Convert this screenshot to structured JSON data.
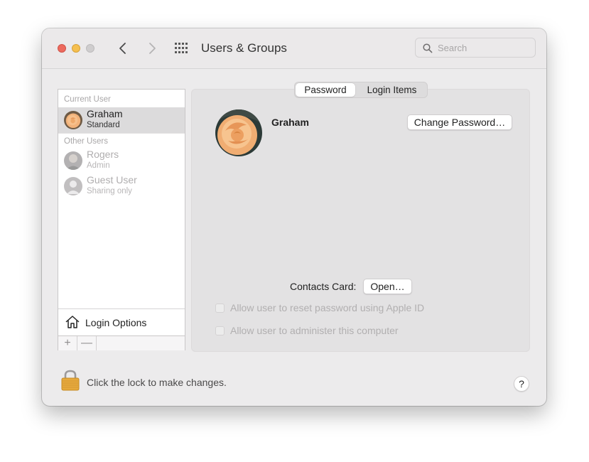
{
  "window": {
    "title": "Users & Groups",
    "search_placeholder": "Search"
  },
  "sidebar": {
    "current_user_label": "Current User",
    "other_users_label": "Other Users",
    "users": [
      {
        "name": "Graham",
        "role": "Standard",
        "avatar": "rose-photo",
        "selected": true,
        "enabled": true
      },
      {
        "name": "Rogers",
        "role": "Admin",
        "avatar": "person-photo",
        "selected": false,
        "enabled": false
      },
      {
        "name": "Guest User",
        "role": "Sharing only",
        "avatar": "generic-person-icon",
        "selected": false,
        "enabled": false
      }
    ],
    "login_options_label": "Login Options",
    "add_label": "+",
    "remove_label": "—"
  },
  "main": {
    "tabs": [
      {
        "label": "Password",
        "selected": true
      },
      {
        "label": "Login Items",
        "selected": false
      }
    ],
    "user_name": "Graham",
    "change_password_label": "Change Password…",
    "contacts_card_label": "Contacts Card:",
    "open_label": "Open…",
    "checkbox_reset": {
      "label": "Allow user to reset password using Apple ID",
      "checked": false,
      "enabled": false
    },
    "checkbox_admin": {
      "label": "Allow user to administer this computer",
      "checked": false,
      "enabled": false
    }
  },
  "footer": {
    "lock_text": "Click the lock to make changes.",
    "help_label": "?"
  },
  "colors": {
    "close": "#ed6a5e",
    "minimize": "#f5bf4f",
    "zoom_disabled": "#cfcdce",
    "selection": "#dcdbdc",
    "lock_gold": "#e6a93c"
  }
}
